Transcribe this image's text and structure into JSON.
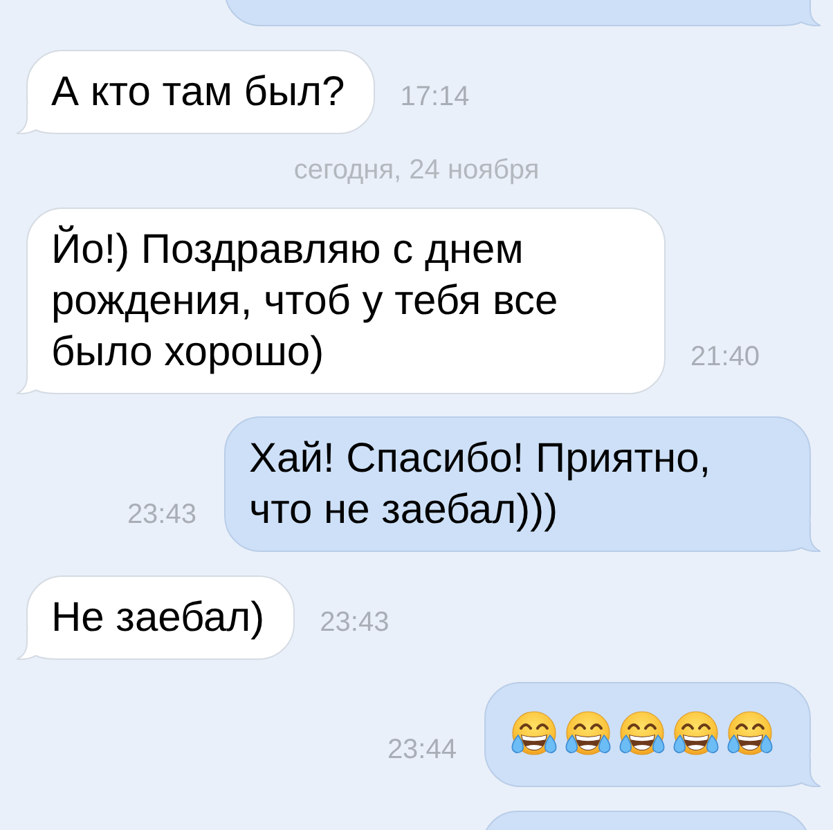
{
  "conversation": {
    "items": [
      {
        "kind": "partial",
        "outgoing": true
      },
      {
        "kind": "text",
        "outgoing": false,
        "text": "А кто там был?",
        "time": "17:14"
      },
      {
        "kind": "date",
        "text": "сегодня, 24 ноября"
      },
      {
        "kind": "text",
        "outgoing": false,
        "text": "Йо!) Поздравляю с днем рождения, чтоб у тебя все было хорошо)",
        "time": "21:40"
      },
      {
        "kind": "text",
        "outgoing": true,
        "text": "Хай! Спасибо! Приятно, что не заебал)))",
        "time": "23:43"
      },
      {
        "kind": "text",
        "outgoing": false,
        "text": "Не заебал)",
        "time": "23:43"
      },
      {
        "kind": "emoji",
        "outgoing": true,
        "emoji": [
          {
            "kind": "tears_of_joy"
          },
          {
            "kind": "tears_of_joy"
          },
          {
            "kind": "tears_of_joy"
          },
          {
            "kind": "tears_of_joy"
          },
          {
            "kind": "tears_of_joy"
          }
        ],
        "time": "23:44"
      },
      {
        "kind": "partial",
        "outgoing": true
      }
    ]
  }
}
